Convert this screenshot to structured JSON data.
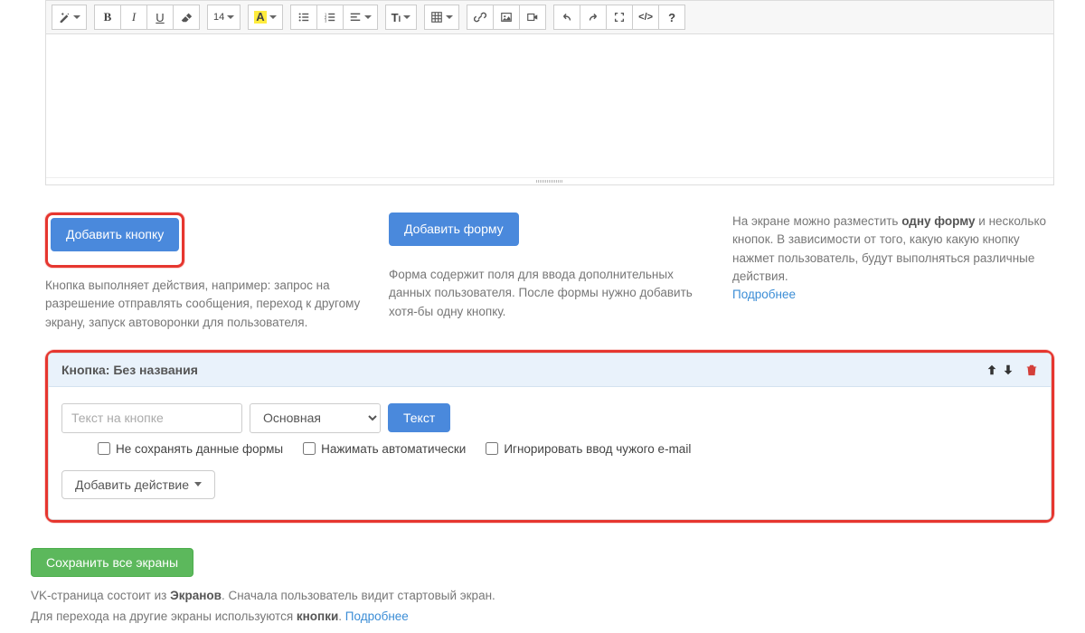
{
  "toolbar": {
    "font_size_label": "14"
  },
  "addButton": {
    "label": "Добавить кнопку",
    "desc": "Кнопка выполняет действия, например: запрос на разрешение отправлять сообщения, переход к другому экрану, запуск автоворонки для пользователя."
  },
  "addForm": {
    "label": "Добавить форму",
    "desc": "Форма содержит поля для ввода дополнительных данных пользователя. После формы нужно добавить хотя-бы одну кнопку."
  },
  "infoCol": {
    "text_pre": "На экране можно разместить ",
    "text_bold": "одну форму",
    "text_post": " и несколько кнопок. В зависимости от того, какую какую кнопку нажмет пользователь, будут выполняться различные действия.",
    "more": "Подробнее"
  },
  "buttonBlock": {
    "title_prefix": "Кнопка: ",
    "title_name": "Без названия",
    "text_placeholder": "Текст на кнопке",
    "style_selected": "Основная",
    "text_btn": "Текст",
    "chk_nosave": "Не сохранять данные формы",
    "chk_auto": "Нажимать автоматически",
    "chk_ignore": "Игнорировать ввод чужого e-mail",
    "add_action": "Добавить действие"
  },
  "saveAll": "Сохранить все экраны",
  "footer": {
    "line1_a": "VK-страница состоит из ",
    "line1_b": "Экранов",
    "line1_c": ". Сначала пользователь видит стартовый экран.",
    "line2_a": "Для перехода на другие экраны используются ",
    "line2_b": "кнопки",
    "line2_c": ". ",
    "more": "Подробнее"
  }
}
